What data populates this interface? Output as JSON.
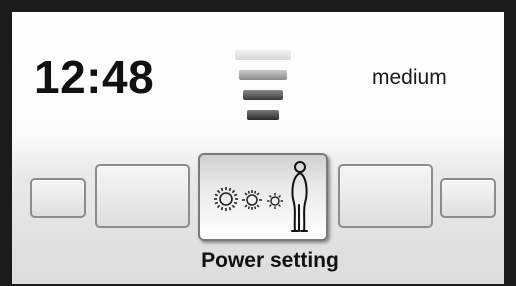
{
  "clock": {
    "time": "12:48"
  },
  "power_level": {
    "label": "medium",
    "bars_total": 4,
    "bars_active": 3
  },
  "carousel": {
    "selected_label": "Power setting",
    "selected_icon": "power-level-person-icon"
  }
}
